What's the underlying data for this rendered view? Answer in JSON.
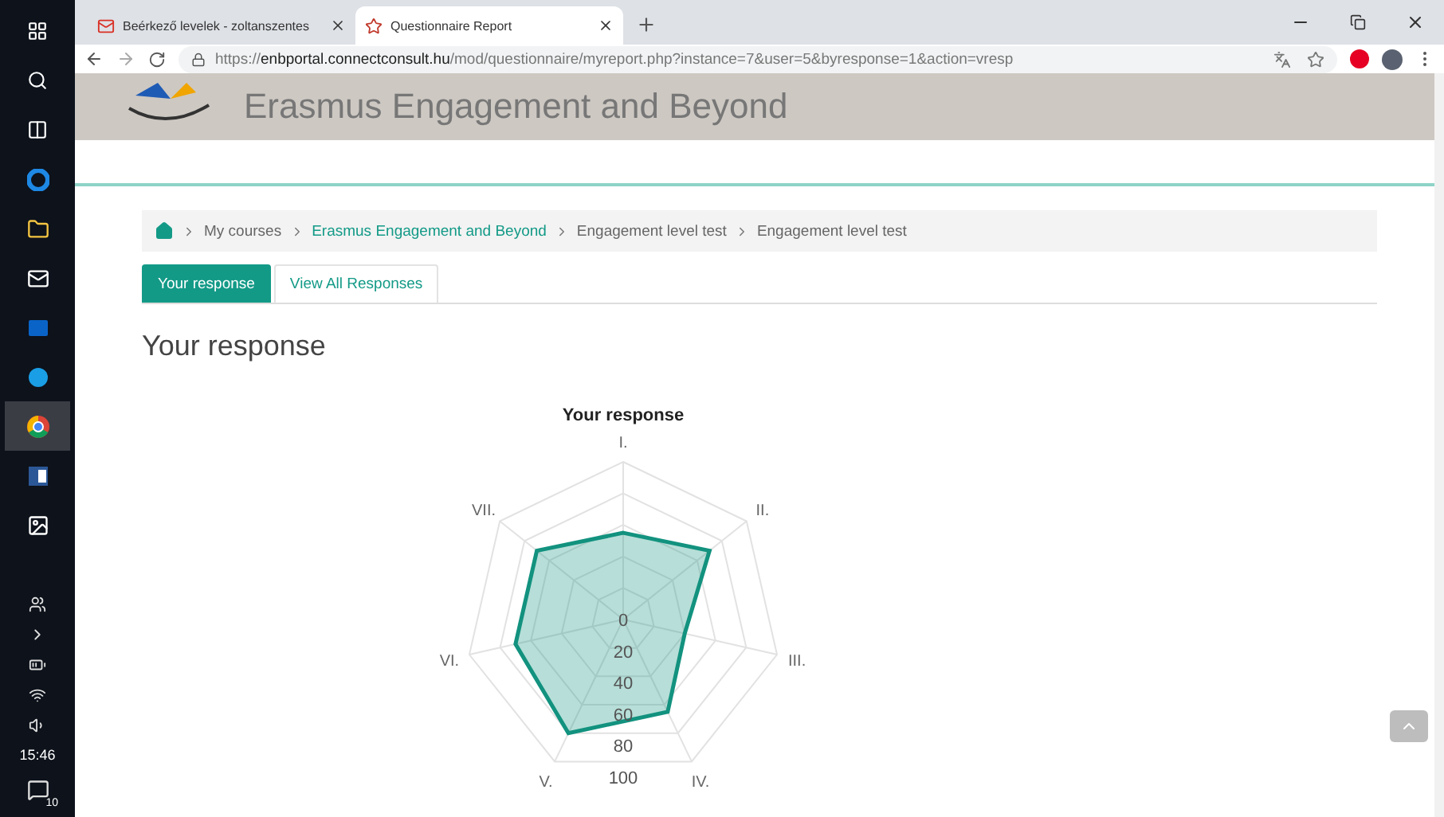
{
  "taskbar": {
    "apps": [
      {
        "kind": "start",
        "selected": false
      },
      {
        "kind": "search",
        "selected": false
      },
      {
        "kind": "taskview",
        "selected": false
      },
      {
        "kind": "edge",
        "selected": false
      },
      {
        "kind": "explorer",
        "selected": false
      },
      {
        "kind": "mail",
        "selected": false
      },
      {
        "kind": "outlook",
        "selected": false
      },
      {
        "kind": "skype",
        "selected": false
      },
      {
        "kind": "chrome",
        "selected": true
      },
      {
        "kind": "word",
        "selected": false
      },
      {
        "kind": "photos",
        "selected": false
      }
    ],
    "clock": "15:46",
    "notifications": "10"
  },
  "browser": {
    "tabs": [
      {
        "title": "Beérkező levelek - zoltanszentes",
        "kind": "mail",
        "selected": false
      },
      {
        "title": "Questionnaire Report",
        "kind": "site",
        "selected": true
      }
    ],
    "url": {
      "scheme": "https://",
      "host": "enbportal.connectconsult.hu",
      "path": "/mod/questionnaire/myreport.php?instance=7&user=5&byresponse=1&action=vresp"
    }
  },
  "site": {
    "title": "Erasmus Engagement and Beyond"
  },
  "breadcrumb": [
    {
      "label": "My courses",
      "kind": "plain"
    },
    {
      "label": "Erasmus Engagement and Beyond",
      "kind": "link"
    },
    {
      "label": "Engagement level test",
      "kind": "plain"
    },
    {
      "label": "Engagement level test",
      "kind": "plain"
    }
  ],
  "tabs": [
    {
      "label": "Your response",
      "selected": true
    },
    {
      "label": "View All Responses",
      "selected": false
    }
  ],
  "heading": "Your response",
  "chart_data": {
    "type": "radar",
    "title": "Your response",
    "categories": [
      "I.",
      "II.",
      "III.",
      "IV.",
      "V.",
      "VI.",
      "VII."
    ],
    "series": [
      {
        "color": "#12927f",
        "values": [
          55,
          70,
          40,
          65,
          80,
          70,
          70
        ]
      }
    ],
    "ylim": [
      0,
      100
    ],
    "yticks": [
      0,
      20,
      40,
      60,
      80,
      100
    ]
  }
}
